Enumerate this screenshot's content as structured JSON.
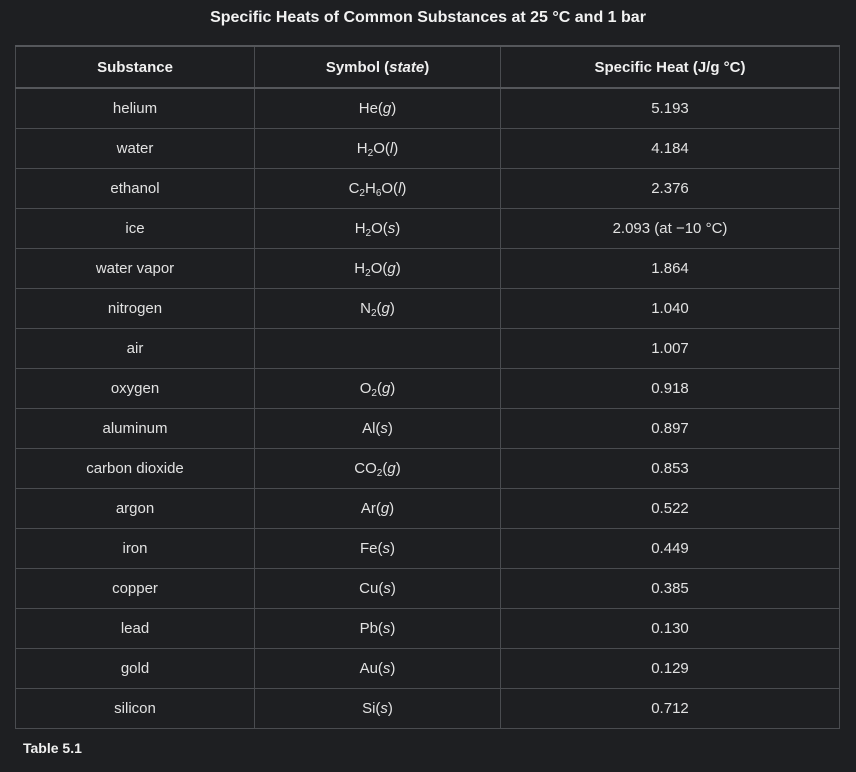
{
  "title": "Specific Heats of Common Substances at 25 °C and 1 bar",
  "headers": {
    "substance": "Substance",
    "symbol_prefix": "Symbol (",
    "symbol_state": "state",
    "symbol_suffix": ")",
    "specific_heat": "Specific Heat (J/g °C)"
  },
  "rows": [
    {
      "substance": "helium",
      "symbol": [
        [
          "He",
          ""
        ],
        [
          "(",
          ""
        ],
        [
          "g",
          "i"
        ],
        [
          ")",
          ""
        ]
      ],
      "value": "5.193"
    },
    {
      "substance": "water",
      "symbol": [
        [
          "H",
          ""
        ],
        [
          "2",
          "sub"
        ],
        [
          "O(",
          ""
        ],
        [
          "l",
          "i"
        ],
        [
          ")",
          ""
        ]
      ],
      "value": "4.184"
    },
    {
      "substance": "ethanol",
      "symbol": [
        [
          "C",
          ""
        ],
        [
          "2",
          "sub"
        ],
        [
          "H",
          ""
        ],
        [
          "6",
          "sub"
        ],
        [
          "O(",
          ""
        ],
        [
          "l",
          "i"
        ],
        [
          ")",
          ""
        ]
      ],
      "value": "2.376"
    },
    {
      "substance": "ice",
      "symbol": [
        [
          "H",
          ""
        ],
        [
          "2",
          "sub"
        ],
        [
          "O(",
          ""
        ],
        [
          "s",
          "i"
        ],
        [
          ")",
          ""
        ]
      ],
      "value": "2.093 (at −10 °C)"
    },
    {
      "substance": "water vapor",
      "symbol": [
        [
          "H",
          ""
        ],
        [
          "2",
          "sub"
        ],
        [
          "O(",
          ""
        ],
        [
          "g",
          "i"
        ],
        [
          ")",
          ""
        ]
      ],
      "value": "1.864"
    },
    {
      "substance": "nitrogen",
      "symbol": [
        [
          "N",
          ""
        ],
        [
          "2",
          "sub"
        ],
        [
          "(",
          ""
        ],
        [
          "g",
          "i"
        ],
        [
          ")",
          ""
        ]
      ],
      "value": "1.040"
    },
    {
      "substance": "air",
      "symbol": [],
      "value": "1.007"
    },
    {
      "substance": "oxygen",
      "symbol": [
        [
          "O",
          ""
        ],
        [
          "2",
          "sub"
        ],
        [
          "(",
          ""
        ],
        [
          "g",
          "i"
        ],
        [
          ")",
          ""
        ]
      ],
      "value": "0.918"
    },
    {
      "substance": "aluminum",
      "symbol": [
        [
          "Al(",
          ""
        ],
        [
          "s",
          "i"
        ],
        [
          ")",
          ""
        ]
      ],
      "value": "0.897"
    },
    {
      "substance": "carbon dioxide",
      "symbol": [
        [
          "CO",
          ""
        ],
        [
          "2",
          "sub"
        ],
        [
          "(",
          ""
        ],
        [
          "g",
          "i"
        ],
        [
          ")",
          ""
        ]
      ],
      "value": "0.853"
    },
    {
      "substance": "argon",
      "symbol": [
        [
          "Ar(",
          ""
        ],
        [
          "g",
          "i"
        ],
        [
          ")",
          ""
        ]
      ],
      "value": "0.522"
    },
    {
      "substance": "iron",
      "symbol": [
        [
          "Fe(",
          ""
        ],
        [
          "s",
          "i"
        ],
        [
          ")",
          ""
        ]
      ],
      "value": "0.449"
    },
    {
      "substance": "copper",
      "symbol": [
        [
          "Cu(",
          ""
        ],
        [
          "s",
          "i"
        ],
        [
          ")",
          ""
        ]
      ],
      "value": "0.385"
    },
    {
      "substance": "lead",
      "symbol": [
        [
          "Pb(",
          ""
        ],
        [
          "s",
          "i"
        ],
        [
          ")",
          ""
        ]
      ],
      "value": "0.130"
    },
    {
      "substance": "gold",
      "symbol": [
        [
          "Au(",
          ""
        ],
        [
          "s",
          "i"
        ],
        [
          ")",
          ""
        ]
      ],
      "value": "0.129"
    },
    {
      "substance": "silicon",
      "symbol": [
        [
          "Si(",
          ""
        ],
        [
          "s",
          "i"
        ],
        [
          ")",
          ""
        ]
      ],
      "value": "0.712"
    }
  ],
  "footer_label": "Table  5.1"
}
